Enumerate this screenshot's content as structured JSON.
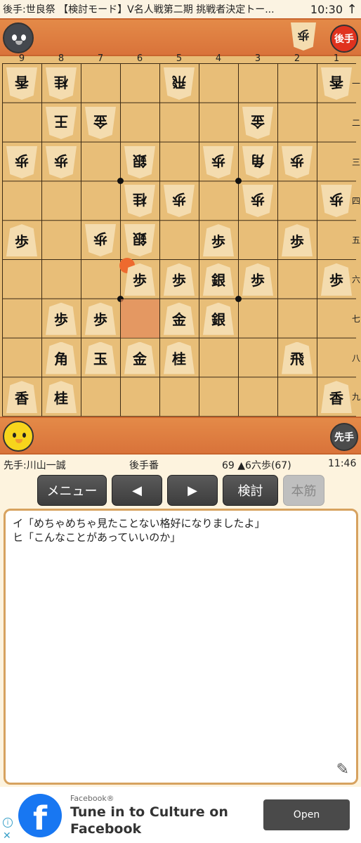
{
  "status_bar": {
    "title": "後手:世良祭 【検討モード】V名人戦第二期 挑戦者決定トー...",
    "time": "10:30",
    "arrow": "↑"
  },
  "gote": {
    "badge": "後手",
    "hand": [
      "歩"
    ]
  },
  "sente": {
    "badge": "先手",
    "hand": []
  },
  "board": {
    "files": [
      "9",
      "8",
      "7",
      "6",
      "5",
      "4",
      "3",
      "2",
      "1"
    ],
    "ranks": [
      "一",
      "二",
      "三",
      "四",
      "五",
      "六",
      "七",
      "八",
      "九"
    ],
    "pieces": [
      {
        "file": 9,
        "rank": 1,
        "label": "香",
        "owner": "gote"
      },
      {
        "file": 8,
        "rank": 1,
        "label": "桂",
        "owner": "gote"
      },
      {
        "file": 5,
        "rank": 1,
        "label": "飛",
        "owner": "gote"
      },
      {
        "file": 1,
        "rank": 1,
        "label": "香",
        "owner": "gote"
      },
      {
        "file": 8,
        "rank": 2,
        "label": "王",
        "owner": "gote"
      },
      {
        "file": 7,
        "rank": 2,
        "label": "金",
        "owner": "gote"
      },
      {
        "file": 3,
        "rank": 2,
        "label": "金",
        "owner": "gote"
      },
      {
        "file": 9,
        "rank": 3,
        "label": "歩",
        "owner": "gote"
      },
      {
        "file": 8,
        "rank": 3,
        "label": "歩",
        "owner": "gote"
      },
      {
        "file": 6,
        "rank": 3,
        "label": "銀",
        "owner": "gote"
      },
      {
        "file": 4,
        "rank": 3,
        "label": "歩",
        "owner": "gote"
      },
      {
        "file": 3,
        "rank": 3,
        "label": "角",
        "owner": "gote"
      },
      {
        "file": 2,
        "rank": 3,
        "label": "歩",
        "owner": "gote"
      },
      {
        "file": 6,
        "rank": 4,
        "label": "桂",
        "owner": "gote"
      },
      {
        "file": 5,
        "rank": 4,
        "label": "歩",
        "owner": "gote"
      },
      {
        "file": 3,
        "rank": 4,
        "label": "歩",
        "owner": "gote"
      },
      {
        "file": 1,
        "rank": 4,
        "label": "歩",
        "owner": "gote"
      },
      {
        "file": 7,
        "rank": 5,
        "label": "歩",
        "owner": "gote"
      },
      {
        "file": 6,
        "rank": 5,
        "label": "銀",
        "owner": "gote"
      },
      {
        "file": 9,
        "rank": 5,
        "label": "歩",
        "owner": "sente"
      },
      {
        "file": 4,
        "rank": 5,
        "label": "歩",
        "owner": "sente"
      },
      {
        "file": 2,
        "rank": 5,
        "label": "歩",
        "owner": "sente"
      },
      {
        "file": 6,
        "rank": 6,
        "label": "歩",
        "owner": "sente"
      },
      {
        "file": 5,
        "rank": 6,
        "label": "歩",
        "owner": "sente"
      },
      {
        "file": 4,
        "rank": 6,
        "label": "銀",
        "owner": "sente"
      },
      {
        "file": 3,
        "rank": 6,
        "label": "歩",
        "owner": "sente"
      },
      {
        "file": 1,
        "rank": 6,
        "label": "歩",
        "owner": "sente"
      },
      {
        "file": 8,
        "rank": 7,
        "label": "歩",
        "owner": "sente"
      },
      {
        "file": 7,
        "rank": 7,
        "label": "歩",
        "owner": "sente"
      },
      {
        "file": 5,
        "rank": 7,
        "label": "金",
        "owner": "sente"
      },
      {
        "file": 4,
        "rank": 7,
        "label": "銀",
        "owner": "sente"
      },
      {
        "file": 8,
        "rank": 8,
        "label": "角",
        "owner": "sente"
      },
      {
        "file": 7,
        "rank": 8,
        "label": "玉",
        "owner": "sente"
      },
      {
        "file": 6,
        "rank": 8,
        "label": "金",
        "owner": "sente"
      },
      {
        "file": 5,
        "rank": 8,
        "label": "桂",
        "owner": "sente"
      },
      {
        "file": 2,
        "rank": 8,
        "label": "飛",
        "owner": "sente"
      },
      {
        "file": 9,
        "rank": 9,
        "label": "香",
        "owner": "sente"
      },
      {
        "file": 8,
        "rank": 9,
        "label": "桂",
        "owner": "sente"
      },
      {
        "file": 1,
        "rank": 9,
        "label": "香",
        "owner": "sente"
      }
    ],
    "last_move_from": {
      "file": 6,
      "rank": 7
    },
    "last_move_to": {
      "file": 6,
      "rank": 6
    }
  },
  "info": {
    "sente_label": "先手:川山一誠",
    "turn_label": "後手番",
    "move_label": "69 ▲6六歩(67)",
    "clock": "11:46"
  },
  "buttons": {
    "menu": "メニュー",
    "prev": "◀",
    "next": "▶",
    "review": "検討",
    "mainline": "本筋"
  },
  "comment": {
    "lines": [
      "イ「めちゃめちゃ見たことない格好になりましたよ」",
      "ヒ「こんなことがあっていいのか」"
    ]
  },
  "ad": {
    "sponsor": "Facebook®",
    "headline": "Tune in to Culture on Facebook",
    "open_label": "Open",
    "info_icon": "i",
    "close_icon": "✕"
  }
}
